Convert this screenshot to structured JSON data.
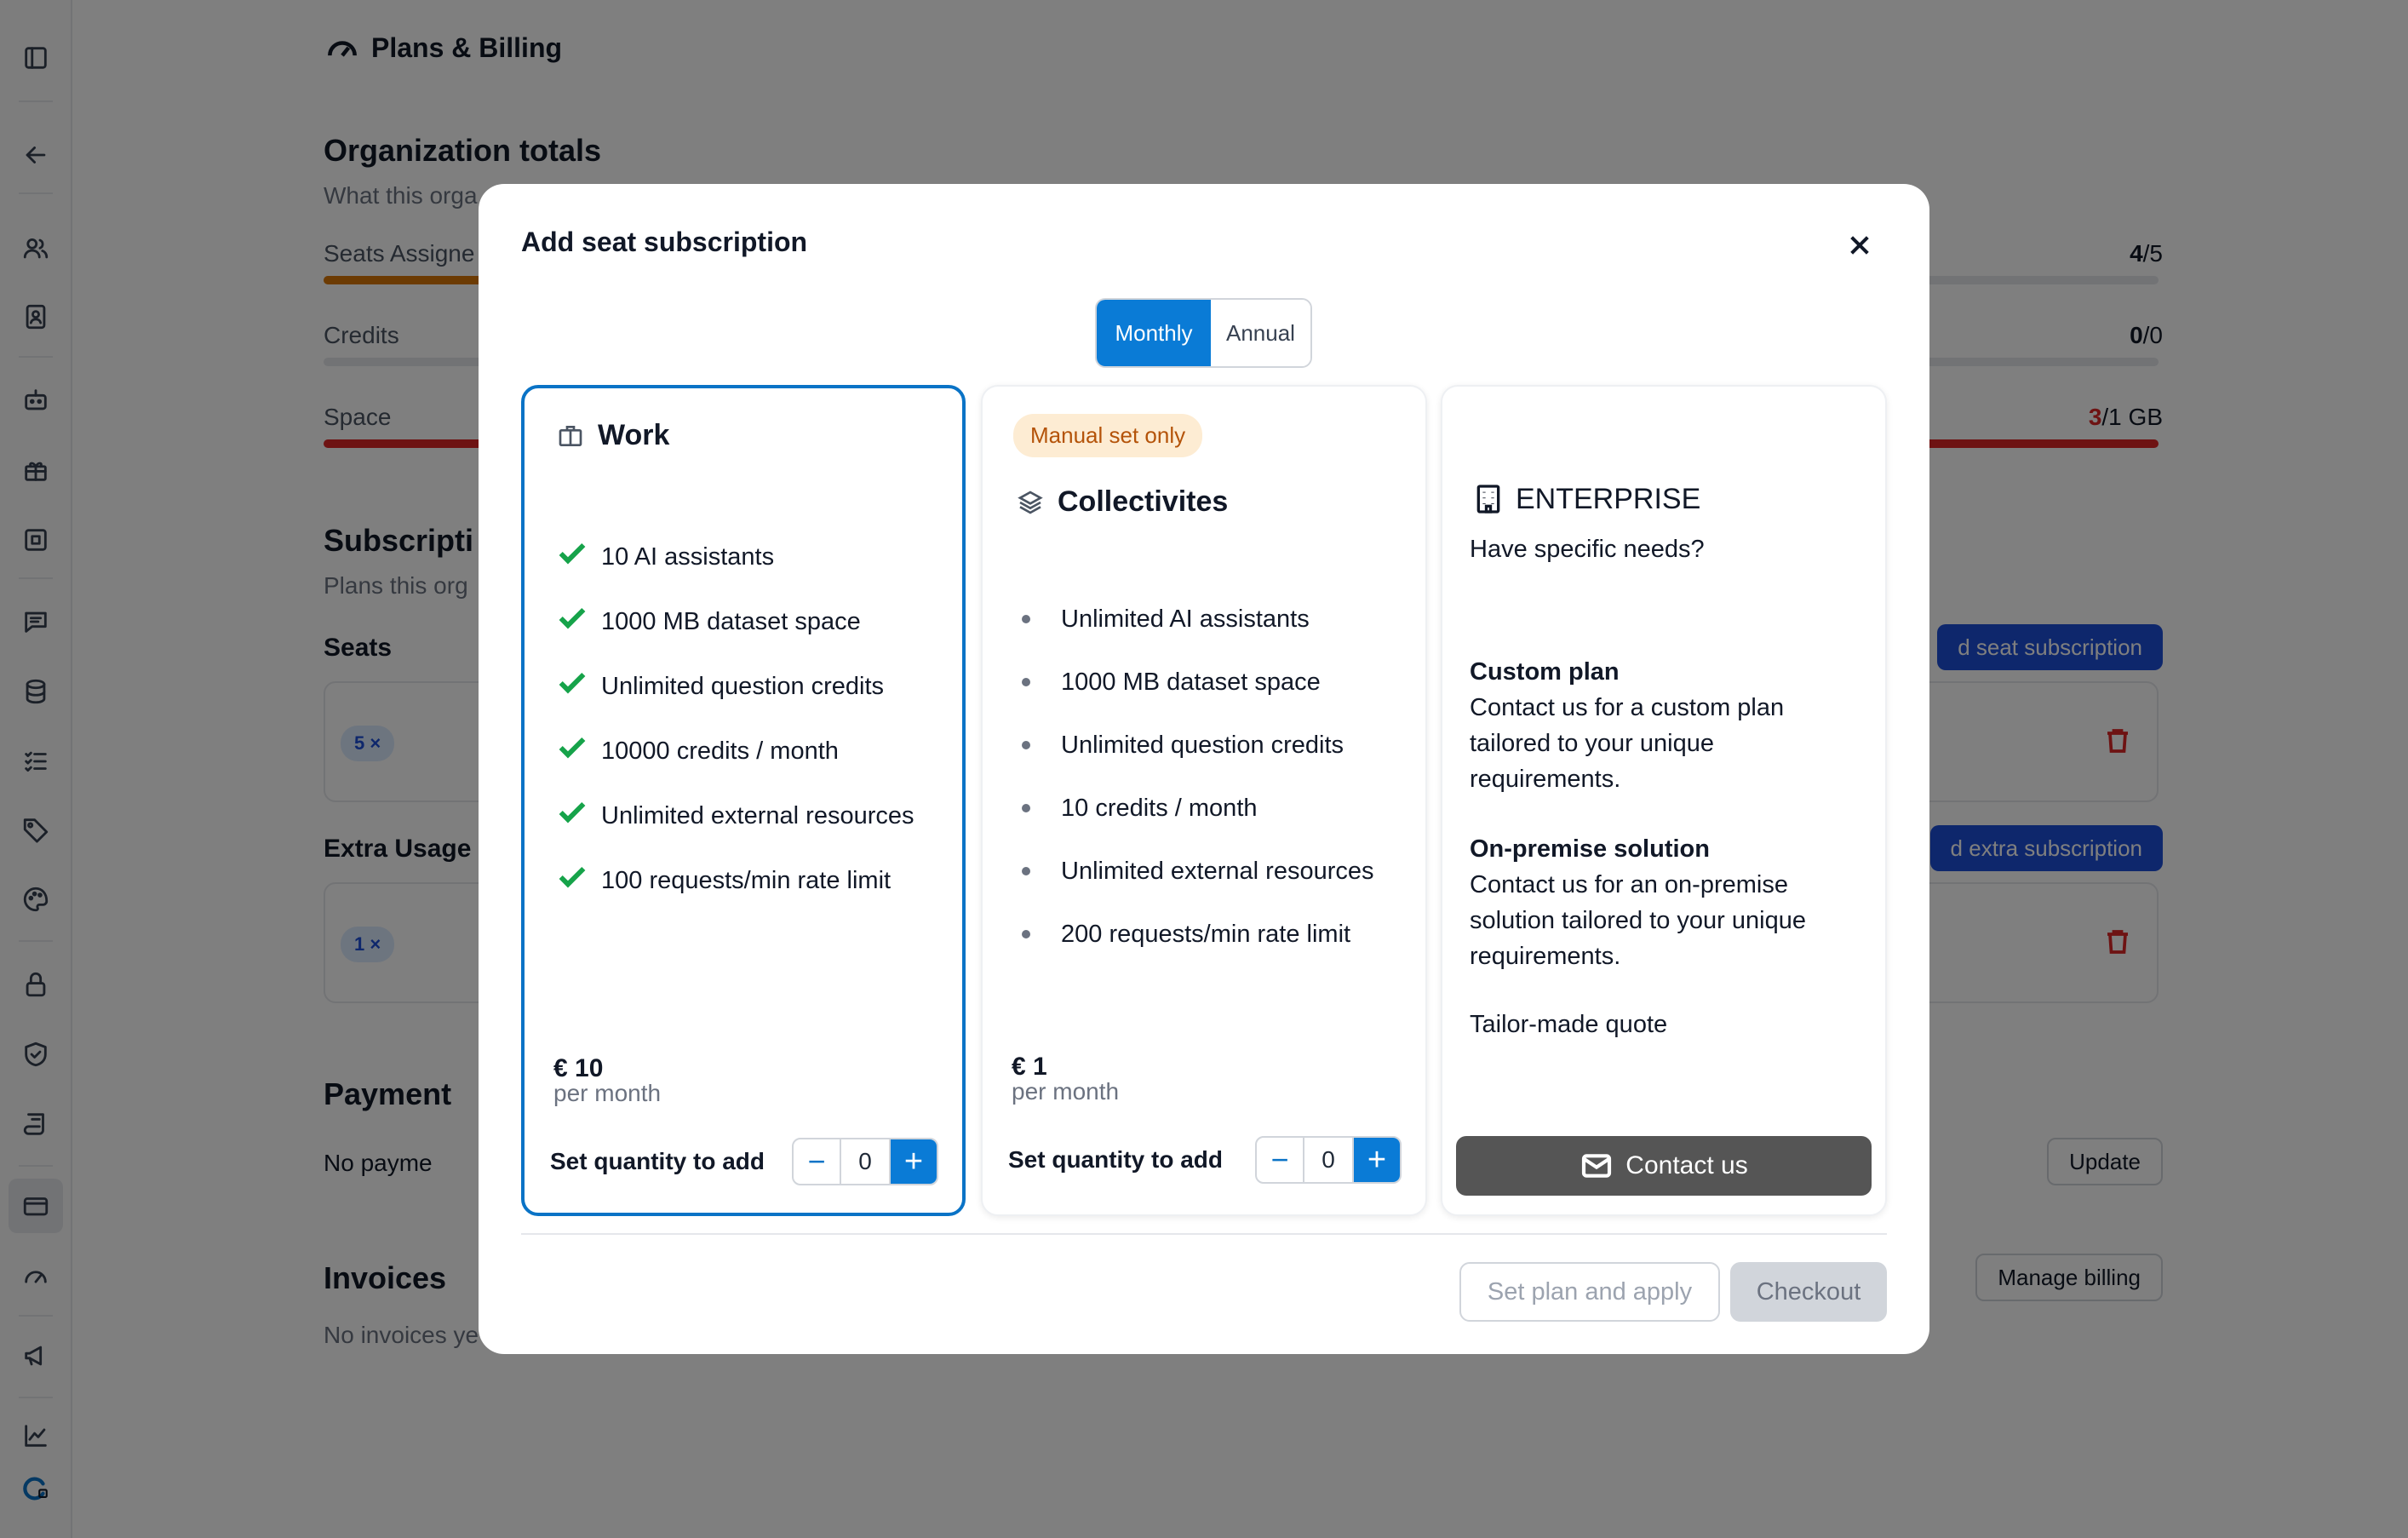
{
  "page": {
    "title": "Plans & Billing",
    "org_totals": {
      "title": "Organization totals",
      "subtitle": "What this orga",
      "rows": [
        {
          "label": "Seats Assigne",
          "value": "4",
          "total": "/5",
          "color": "#d97706",
          "fill": 0.8
        },
        {
          "label": "Credits",
          "value": "0",
          "total": "/0",
          "color": "#e5e7eb",
          "fill": 0
        },
        {
          "label": "Space",
          "value": "3",
          "total": "/1 GB",
          "color": "#dc2626",
          "fill": 1
        }
      ]
    },
    "subscriptions": {
      "title": "Subscripti",
      "subtitle": "Plans this org",
      "seats_label": "Seats",
      "seats_chip": "5 ×",
      "seats_button": "d seat subscription",
      "extra_label": "Extra Usage",
      "extra_chip": "1 ×",
      "extra_button": "d extra subscription"
    },
    "payment": {
      "title": "Payment",
      "method_text": "No payme",
      "update_button": "Update"
    },
    "invoices": {
      "title": "Invoices",
      "empty_text": "No invoices ye",
      "manage_button": "Manage billing"
    }
  },
  "sidebar": {
    "icons": [
      "sidebar-toggle-icon",
      "back-arrow-icon",
      "users-icon",
      "contacts-icon",
      "robot-icon",
      "gift-icon",
      "scan-icon",
      "chat-icon",
      "database-icon",
      "checklist-icon",
      "tag-icon",
      "palette-icon",
      "lock-icon",
      "shield-icon",
      "certificate-icon",
      "credit-card-icon",
      "gauge-icon",
      "megaphone-icon",
      "chart-icon",
      "logo-icon"
    ]
  },
  "modal": {
    "title": "Add seat subscription",
    "billing_toggle": {
      "monthly": "Monthly",
      "annual": "Annual",
      "selected": "Monthly"
    },
    "plans": {
      "work": {
        "name": "Work",
        "features": [
          "10 AI assistants",
          "1000 MB dataset space",
          "Unlimited question credits",
          "10000 credits / month",
          "Unlimited external resources",
          "100 requests/min rate limit"
        ],
        "price": "€ 10",
        "period": "per month",
        "qty_label": "Set quantity to add",
        "qty": "0"
      },
      "collectivities": {
        "badge": "Manual set only",
        "name": "Collectivites",
        "features": [
          "Unlimited AI assistants",
          "1000 MB dataset space",
          "Unlimited question credits",
          "10 credits / month",
          "Unlimited external resources",
          "200 requests/min rate limit"
        ],
        "price": "€ 1",
        "period": "per month",
        "qty_label": "Set quantity to add",
        "qty": "0"
      },
      "enterprise": {
        "name": "ENTERPRISE",
        "tagline": "Have specific needs?",
        "custom_title": "Custom plan",
        "custom_desc": "Contact us for a custom plan tailored to your unique requirements.",
        "onprem_title": "On-premise solution",
        "onprem_desc": "Contact us for an on-premise solution tailored to your unique requirements.",
        "quote": "Tailor-made quote",
        "contact_button": "Contact us"
      }
    },
    "footer": {
      "apply_button": "Set plan and apply",
      "checkout_button": "Checkout"
    }
  }
}
